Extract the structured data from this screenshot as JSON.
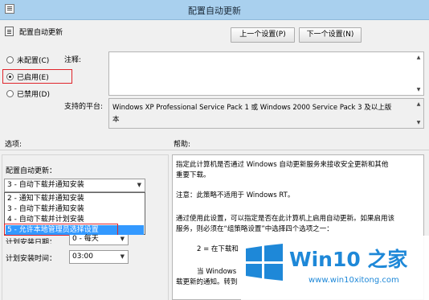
{
  "window": {
    "title": "配置自动更新"
  },
  "header": {
    "policy_name": "配置自动更新"
  },
  "nav": {
    "prev_button": "上一个设置(P)",
    "next_button": "下一个设置(N)"
  },
  "state_options": [
    {
      "label": "未配置(C)",
      "selected": false
    },
    {
      "label": "已启用(E)",
      "selected": true
    },
    {
      "label": "已禁用(D)",
      "selected": false
    }
  ],
  "comment": {
    "label": "注释:",
    "value": ""
  },
  "supported": {
    "label": "支持的平台:",
    "value_line1": "Windows XP Professional Service Pack 1 或 Windows 2000 Service Pack 3 及以上版",
    "value_line2": "本"
  },
  "options_section": {
    "heading": "选项:",
    "configure_label": "配置自动更新：",
    "combo_value": "3 - 自动下载并通知安装",
    "dropdown_items": [
      "2 - 通知下载并通知安装",
      "3 - 自动下载并通知安装",
      "4 - 自动下载并计划安装",
      "5 - 允许本地管理员选择设置"
    ],
    "dropdown_selected_index": 3,
    "schedule_day_label": "计划安装日期：",
    "schedule_day_value": "0 - 每天",
    "schedule_time_label": "计划安装时间：",
    "schedule_time_value": "03:00"
  },
  "help_section": {
    "heading": "帮助:",
    "p1_line1": "指定此计算机是否通过 Windows 自动更新服务来接收安全更新和其他",
    "p1_line2": "重要下载。",
    "p2": "注意：此策略不适用于 Windows RT。",
    "p3_line1": "通过使用此设置，可以指定是否在此计算机上启用自动更新。如果启用该",
    "p3_line2": "服务，则必须在“组策略设置”中选择四个选项之一：",
    "p4": "2 = 在下载和",
    "p5_line1": "当 Windows",
    "p5_line2": "载更新的通知。转到"
  },
  "watermark": {
    "brand": "Win10 之家",
    "url": "www.win10xitong.com"
  },
  "colors": {
    "titlebar": "#a9d0ee",
    "highlight_box": "#e0252b",
    "selection": "#3399ff",
    "logo_blue": "#1e88d8"
  }
}
